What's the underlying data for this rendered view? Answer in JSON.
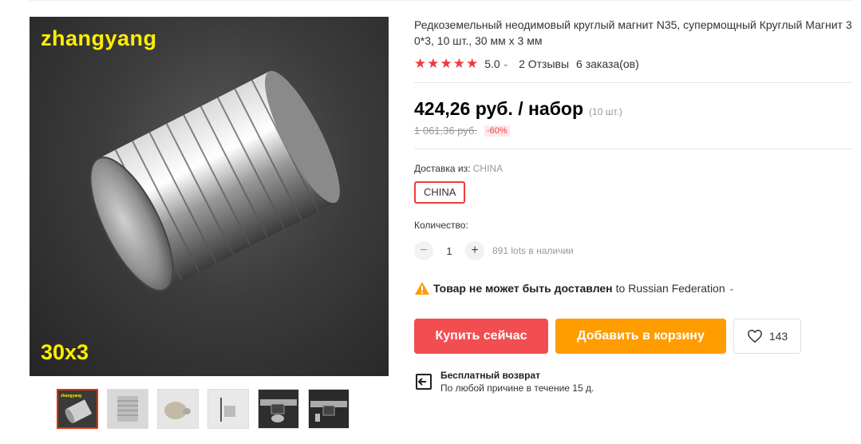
{
  "product": {
    "title": "Редкоземельный неодимовый круглый магнит N35, супермощный Круглый Магнит 30*3, 10 шт., 30 мм x 3 мм",
    "main_image": {
      "watermark_top": "zhangyang",
      "watermark_bottom": "30x3"
    },
    "thumbnails": [
      {
        "name": "magnet-stack-dark",
        "active": true,
        "label": "zhangyang"
      },
      {
        "name": "magnet-stack-light",
        "active": false
      },
      {
        "name": "single-magnet",
        "active": false
      },
      {
        "name": "magnet-thickness",
        "active": false
      },
      {
        "name": "caliper-measure",
        "active": false
      },
      {
        "name": "caliper-thickness",
        "active": false
      }
    ]
  },
  "rating": {
    "stars": "★★★★★",
    "score": "5.0",
    "reviews": "2 Отзывы",
    "orders": "6 заказа(ов)"
  },
  "price": {
    "current": "424,26 руб. / набор",
    "unit_note": "(10 шт.)",
    "old": "1 061,36 руб.",
    "discount": "-60%"
  },
  "shipping": {
    "label": "Доставка из:",
    "value": "CHINA",
    "option": "CHINA"
  },
  "quantity": {
    "label": "Количество:",
    "minus": "−",
    "value": "1",
    "plus": "+",
    "stock": "891 lots в наличии"
  },
  "warning": {
    "bold": "Товар не может быть доставлен",
    "to": "to Russian Federation"
  },
  "actions": {
    "buy_now": "Купить сейчас",
    "add_to_cart": "Добавить в корзину",
    "wishlist_count": "143"
  },
  "returns": {
    "title": "Бесплатный возврат",
    "subtitle": "По любой причине в течение 15 д."
  },
  "colors": {
    "accent_red": "#f24e51",
    "cart_orange": "#ff9c00",
    "star_red": "#f03a3a"
  }
}
